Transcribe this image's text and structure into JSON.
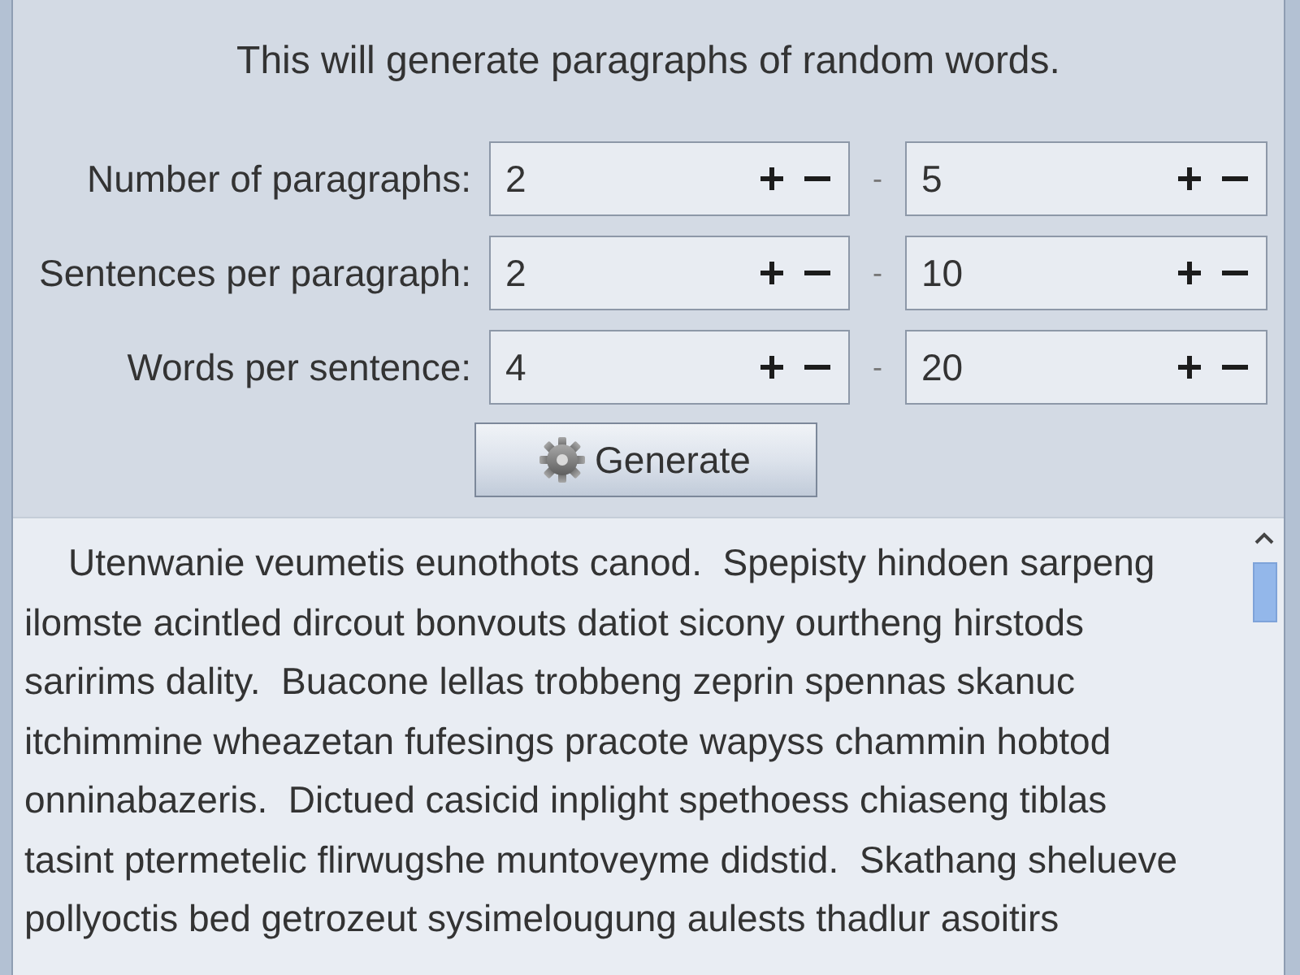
{
  "header": {
    "text": "This will generate paragraphs of random words."
  },
  "ranges": [
    {
      "label": "Number of paragraphs:",
      "min": "2",
      "separator": "-",
      "max": "5"
    },
    {
      "label": "Sentences per paragraph:",
      "min": "2",
      "separator": "-",
      "max": "10"
    },
    {
      "label": "Words per sentence:",
      "min": "4",
      "separator": "-",
      "max": "20"
    }
  ],
  "generate_button": {
    "label": "Generate"
  },
  "output": {
    "lines": [
      "Utenwanie veumetis eunothots canod.  Spepisty hindoen sarpeng",
      "ilomste acintled dircout bonvouts datiot sicony ourtheng hirstods",
      "saririms dality.  Buacone lellas trobbeng zeprin spennas skanuc",
      "itchimmine wheazetan fufesings pracote wapyss chammin hobtod",
      "onninabazeris.  Dictued casicid inplight spethoess chiaseng tiblas",
      "tasint ptermetelic flirwugshe muntoveyme didstid.  Skathang shelueve",
      "pollyoctis bed getrozeut sysimelougung aulests thadlur asoitirs"
    ]
  }
}
